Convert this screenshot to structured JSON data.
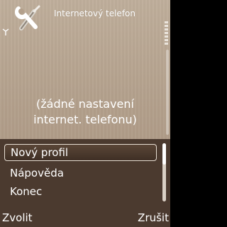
{
  "header": {
    "title": "Internetový telefon",
    "app_icon": "wrench-screwdriver-icon",
    "signal_icon": "antenna-signal-icon"
  },
  "main": {
    "empty_line1": "(žádné nastavení",
    "empty_line2": "internet. telefonu)"
  },
  "menu": {
    "items": [
      {
        "label": "Nový profil",
        "selected": true
      },
      {
        "label": "Nápověda",
        "selected": false
      },
      {
        "label": "Konec",
        "selected": false
      }
    ]
  },
  "softkeys": {
    "left": "Zvolit",
    "right": "Zrušit"
  },
  "colors": {
    "background": "#b3a08c",
    "menu_background": "#4b3a2f",
    "text": "#ffffff"
  }
}
